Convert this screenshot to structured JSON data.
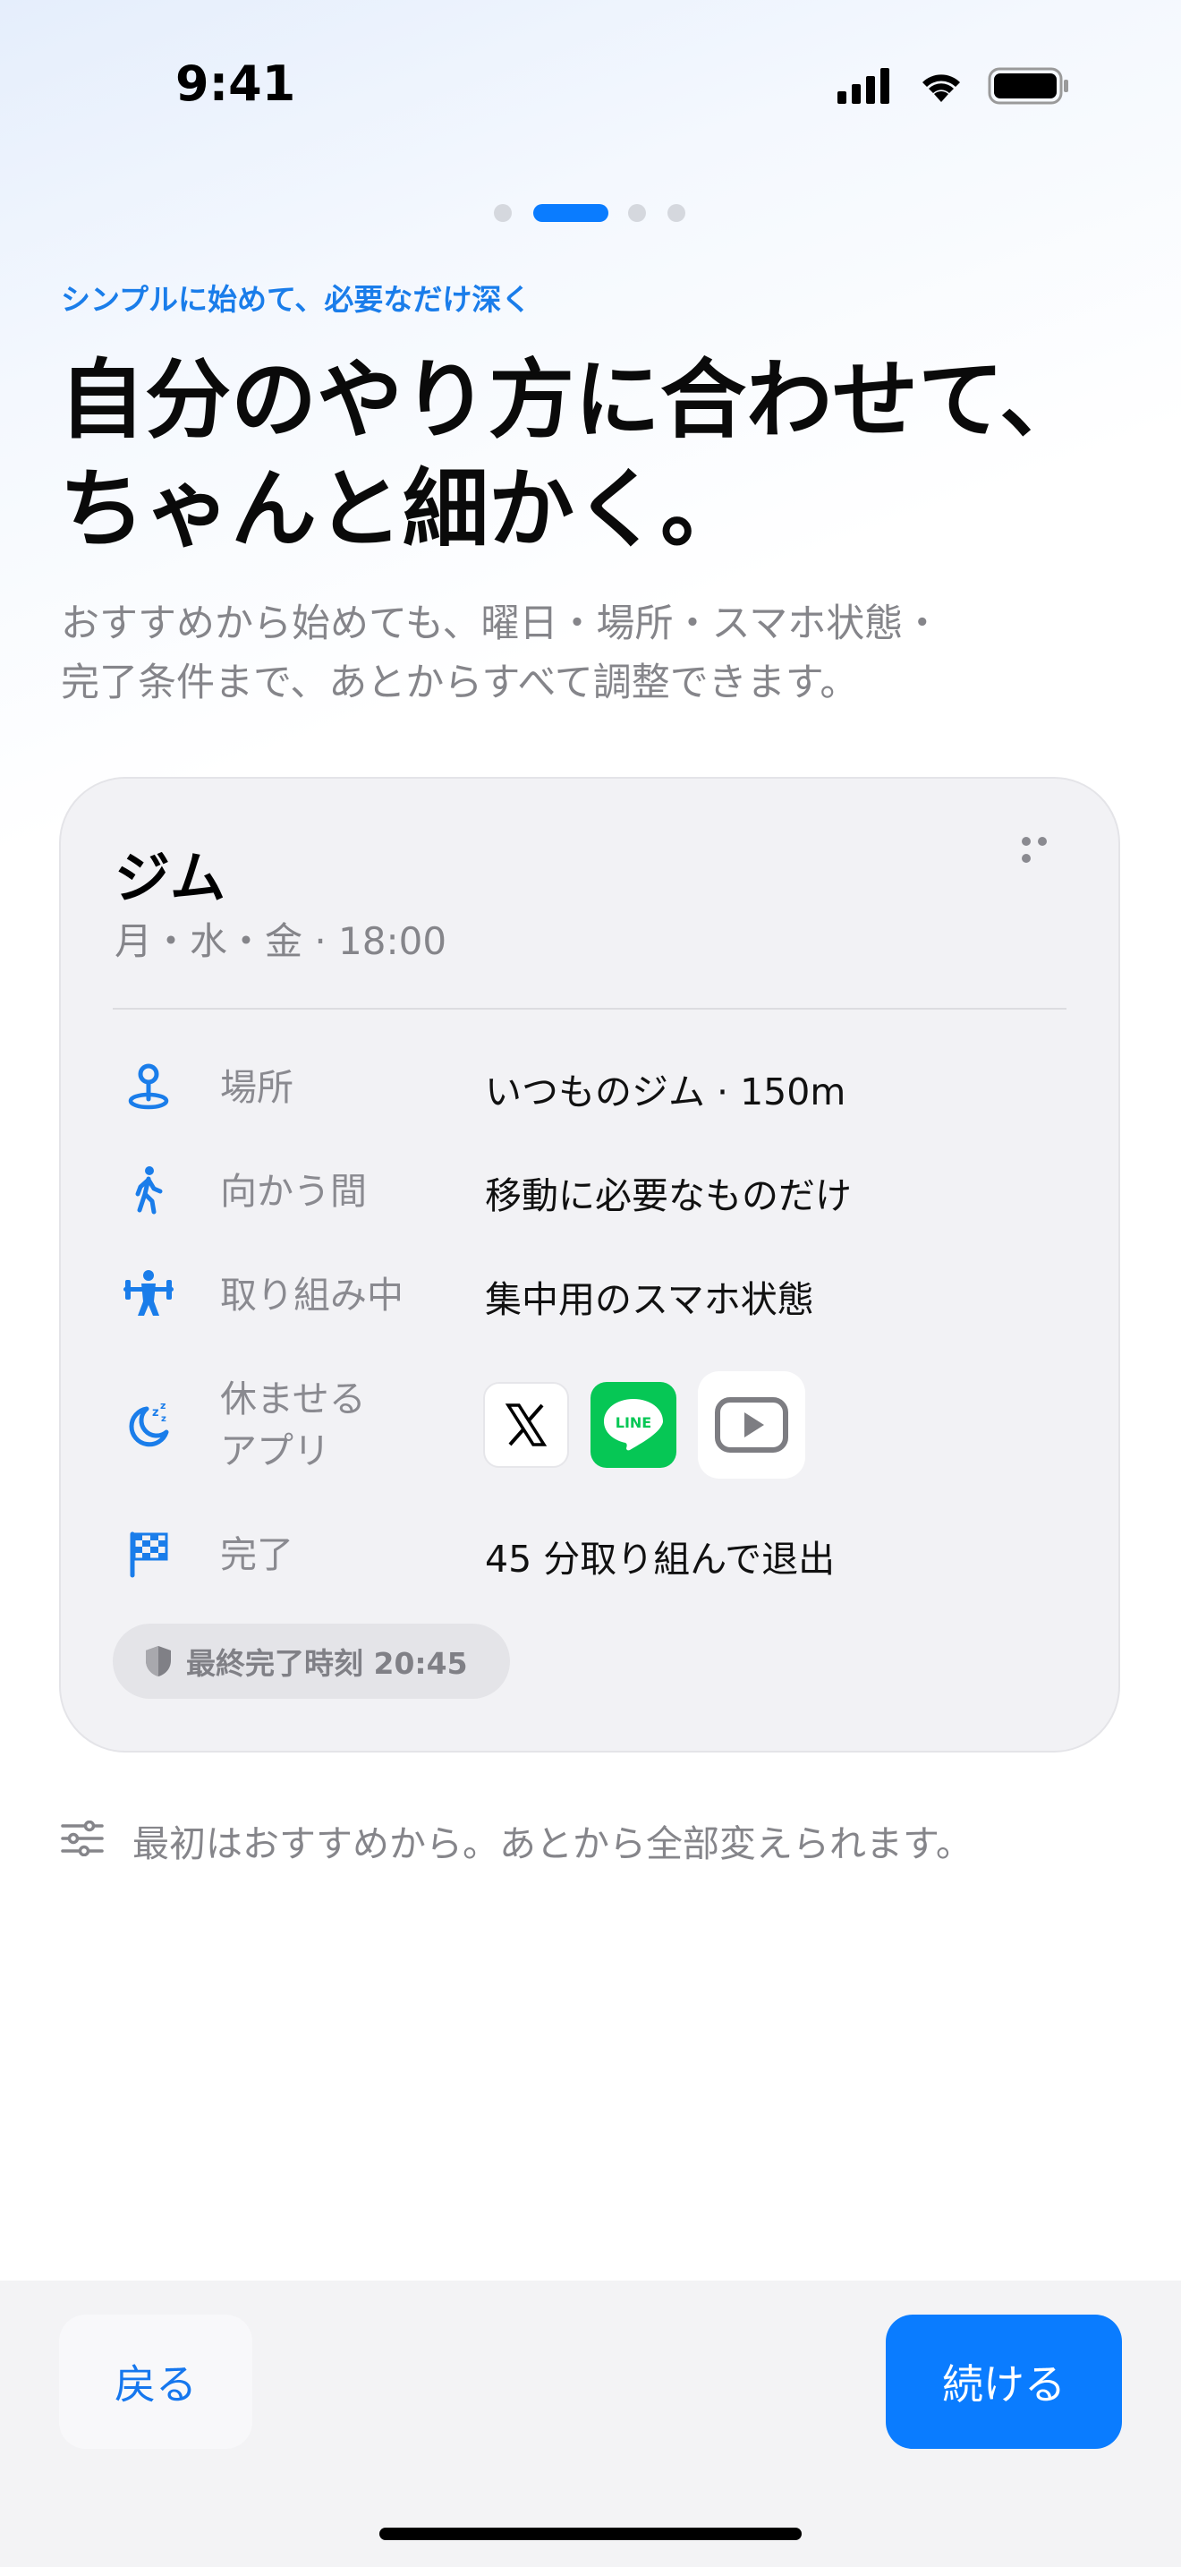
{
  "status_bar": {
    "time": "9:41"
  },
  "pager": {
    "count": 4,
    "active_index": 1
  },
  "eyebrow": "シンプルに始めて、必要なだけ深く",
  "headline": "自分のやり方に合わせて、\nちゃんと細かく。",
  "subhead": "おすすめから始めても、曜日・場所・スマホ状態・\n完了条件まで、あとからすべて調整できます。",
  "card": {
    "title": "ジム",
    "subtitle": "月・水・金 · 18:00",
    "rows": [
      {
        "icon": "location-pin-icon",
        "label": "場所",
        "value": "いつものジム · 150m"
      },
      {
        "icon": "walking-person-icon",
        "label": "向かう間",
        "value": "移動に必要なものだけ"
      },
      {
        "icon": "weightlifting-icon",
        "label": "取り組み中",
        "value": "集中用のスマホ状態"
      },
      {
        "icon": "moon-sleep-icon",
        "label": "休ませる\nアプリ",
        "apps": [
          "X",
          "LINE",
          "YouTube"
        ]
      },
      {
        "icon": "checkered-flag-icon",
        "label": "完了",
        "value": "45 分取り組んで退出"
      }
    ],
    "badge": "最終完了時刻 20:45"
  },
  "hint": "最初はおすすめから。あとから全部変えられます。",
  "buttons": {
    "back": "戻る",
    "continue": "続ける"
  },
  "colors": {
    "accent": "#0a7cff",
    "line_green": "#06c755"
  }
}
